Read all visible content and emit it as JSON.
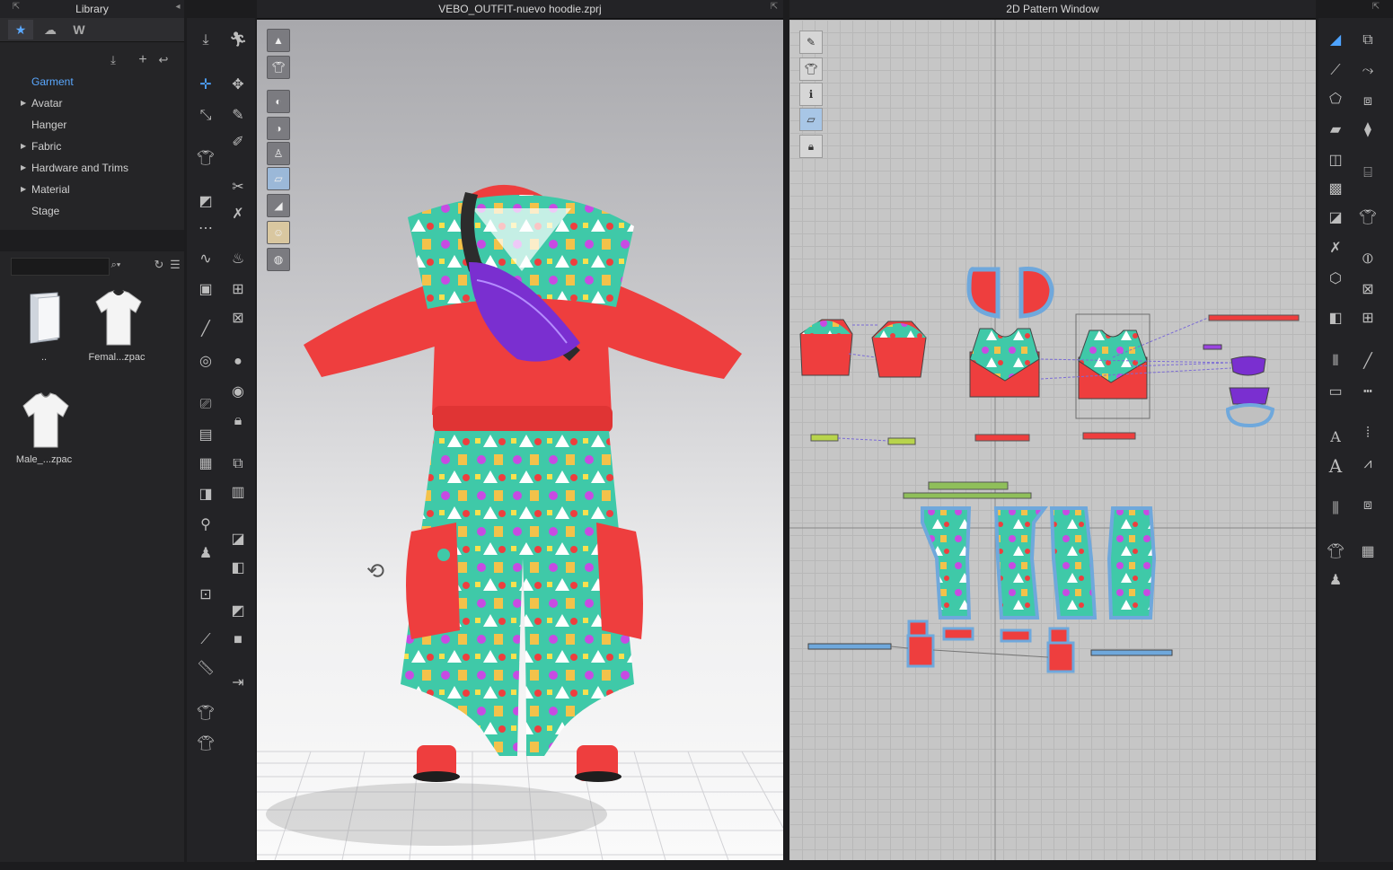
{
  "library": {
    "title": "Library",
    "tabs": [
      "favorites-star",
      "cloud",
      "w-logo"
    ],
    "tree": [
      {
        "label": "Garment",
        "selected": true,
        "expandable": false
      },
      {
        "label": "Avatar",
        "selected": false,
        "expandable": true
      },
      {
        "label": "Hanger",
        "selected": false,
        "expandable": false
      },
      {
        "label": "Fabric",
        "selected": false,
        "expandable": true
      },
      {
        "label": "Hardware and Trims",
        "selected": false,
        "expandable": true
      },
      {
        "label": "Material",
        "selected": false,
        "expandable": true
      },
      {
        "label": "Stage",
        "selected": false,
        "expandable": false
      }
    ],
    "search_value": "",
    "files": [
      {
        "label": "..",
        "icon": "folder-icon"
      },
      {
        "label": "Femal...zpac",
        "icon": "tshirt-dark-collar-icon"
      },
      {
        "label": "Male_...zpac",
        "icon": "tshirt-icon"
      }
    ]
  },
  "viewport3d": {
    "title": "VEBO_OUTFIT-nuevo hoodie.zprj"
  },
  "pattern2d": {
    "title": "2D Pattern Window"
  },
  "colors": {
    "accent": "#4ea3ff",
    "garment_red": "#ee3e3e",
    "print_teal": "#3fc9a8",
    "bag_purple": "#7a2fd0",
    "binding_green": "#8fbf5a"
  }
}
